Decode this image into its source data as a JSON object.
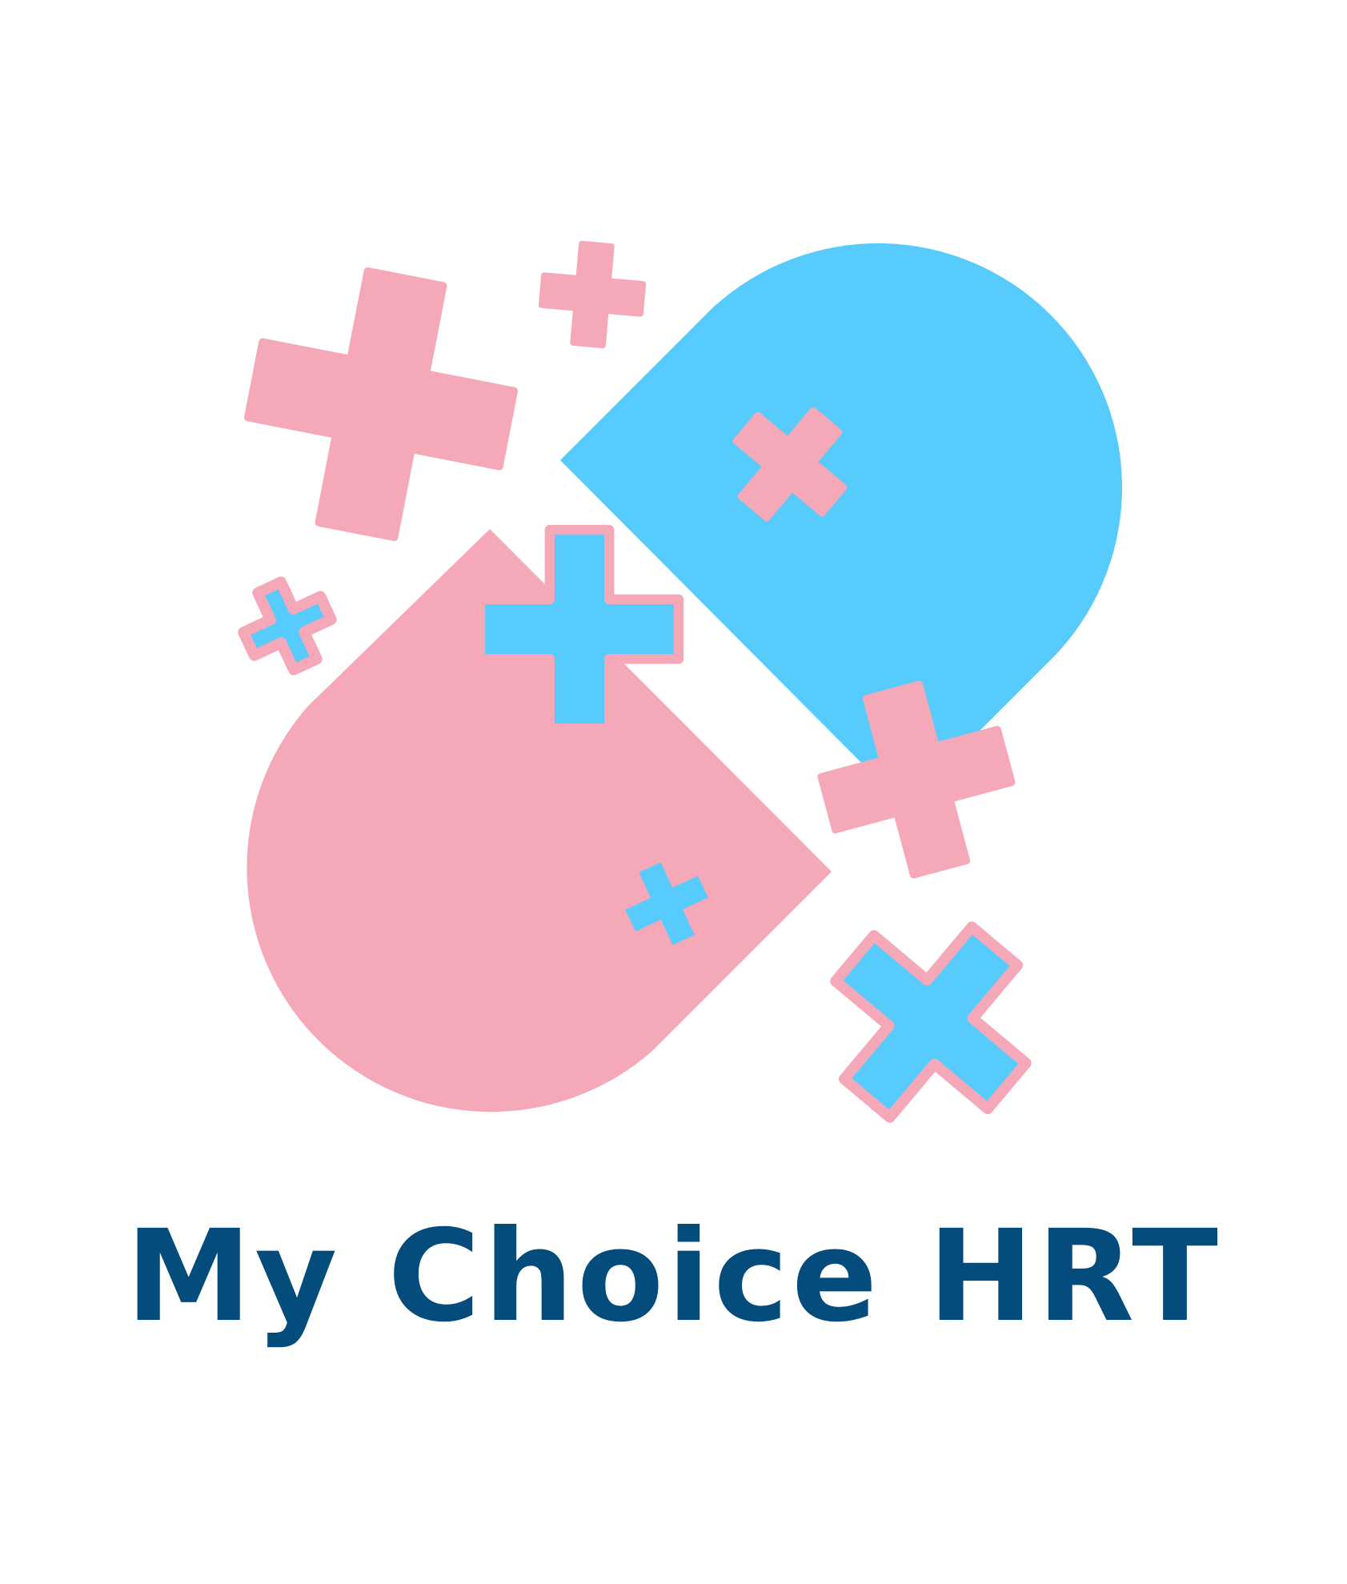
{
  "brand": {
    "name": "My Choice HRT"
  },
  "logo": {
    "icon": "capsule-with-plus-signs-icon",
    "colors": {
      "pink": "#F5A8B8",
      "blue": "#56CBFC",
      "navy": "#034C7C",
      "background": "#FFFFFF"
    }
  }
}
